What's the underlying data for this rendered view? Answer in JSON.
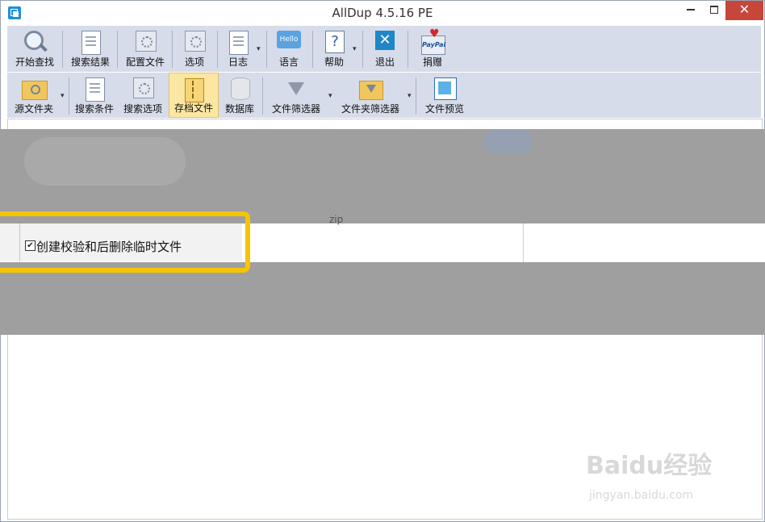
{
  "window": {
    "title": "AllDup 4.5.16 PE",
    "close_glyph": "✕"
  },
  "toolbar_main": [
    {
      "label": "开始查找",
      "icon": "search-icon"
    },
    {
      "label": "搜索结果",
      "icon": "results-icon"
    },
    {
      "label": "配置文件",
      "icon": "profile-icon"
    },
    {
      "label": "选项",
      "icon": "options-icon"
    },
    {
      "label": "日志",
      "icon": "log-icon"
    },
    {
      "label": "语言",
      "icon": "language-icon",
      "icon_text": "Hello"
    },
    {
      "label": "帮助",
      "icon": "help-icon",
      "icon_text": "?"
    },
    {
      "label": "退出",
      "icon": "exit-icon",
      "icon_text": "✕"
    },
    {
      "label": "捐赠",
      "icon": "paypal-icon",
      "icon_text": "PayPal"
    }
  ],
  "toolbar_secondary": [
    {
      "label": "源文件夹",
      "icon": "source-folder-icon"
    },
    {
      "label": "搜索条件",
      "icon": "search-criteria-icon"
    },
    {
      "label": "搜索选项",
      "icon": "search-options-icon"
    },
    {
      "label": "存档文件",
      "icon": "archive-icon",
      "active": true
    },
    {
      "label": "数据库",
      "icon": "database-icon"
    },
    {
      "label": "文件筛选器",
      "icon": "file-filter-icon"
    },
    {
      "label": "文件夹筛选器",
      "icon": "folder-filter-icon"
    },
    {
      "label": "文件预览",
      "icon": "file-preview-icon"
    }
  ],
  "option": {
    "label": "创建校验和后删除临时文件",
    "checked": true,
    "check_glyph": "✔"
  },
  "faint_text": "zip",
  "watermark": {
    "line1": "Baidu经验",
    "line2": "jingyan.baidu.com"
  },
  "colors": {
    "toolbar_bg": "#d6dce9",
    "highlight": "#f6c400",
    "close_button": "#c7463a"
  }
}
